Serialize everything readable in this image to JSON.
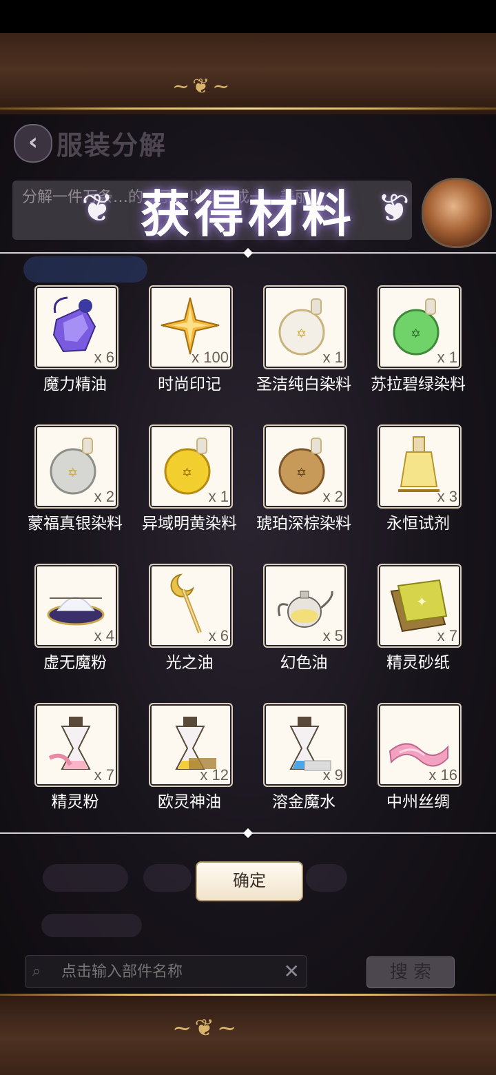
{
  "header": {
    "page_title": "服装分解",
    "back_label": "‹"
  },
  "description": {
    "text": "分解一件万条…的…子…以凝华成一…美丽…"
  },
  "banner": {
    "title": "获得材料"
  },
  "items": [
    {
      "name": "魔力精油",
      "qty": "x 6",
      "icon": "purple-crystal-bottle-icon"
    },
    {
      "name": "时尚印记",
      "qty": "x 100",
      "icon": "gold-star-mark-icon"
    },
    {
      "name": "圣洁纯白染料",
      "qty": "x 1",
      "icon": "white-dye-flask-icon"
    },
    {
      "name": "苏拉碧绿染料",
      "qty": "x 1",
      "icon": "green-dye-flask-icon"
    },
    {
      "name": "蒙福真银染料",
      "qty": "x 2",
      "icon": "silver-dye-flask-icon"
    },
    {
      "name": "异域明黄染料",
      "qty": "x 1",
      "icon": "yellow-dye-flask-icon"
    },
    {
      "name": "琥珀深棕染料",
      "qty": "x 2",
      "icon": "amber-dye-flask-icon"
    },
    {
      "name": "永恒试剂",
      "qty": "x 3",
      "icon": "eternal-reagent-jar-icon"
    },
    {
      "name": "虚无魔粉",
      "qty": "x 4",
      "icon": "powder-bowl-icon"
    },
    {
      "name": "光之油",
      "qty": "x 6",
      "icon": "moon-wand-icon"
    },
    {
      "name": "幻色油",
      "qty": "x 5",
      "icon": "teapot-icon"
    },
    {
      "name": "精灵砂纸",
      "qty": "x 7",
      "icon": "sandpaper-icon"
    },
    {
      "name": "精灵粉",
      "qty": "x 7",
      "icon": "pink-hourglass-icon"
    },
    {
      "name": "欧灵神油",
      "qty": "x 12",
      "icon": "gold-hourglass-icon"
    },
    {
      "name": "溶金魔水",
      "qty": "x 9",
      "icon": "blue-hourglass-icon"
    },
    {
      "name": "中州丝绸",
      "qty": "x 16",
      "icon": "pink-silk-icon"
    }
  ],
  "confirm_label": "确定",
  "search": {
    "placeholder": "点击输入部件名称",
    "button_label": "搜 索",
    "clear_label": "✕"
  },
  "colors": {
    "accent_gold": "#d9b56a",
    "banner_glow": "#9b86c9",
    "card_bg": "#fdf9f1"
  }
}
